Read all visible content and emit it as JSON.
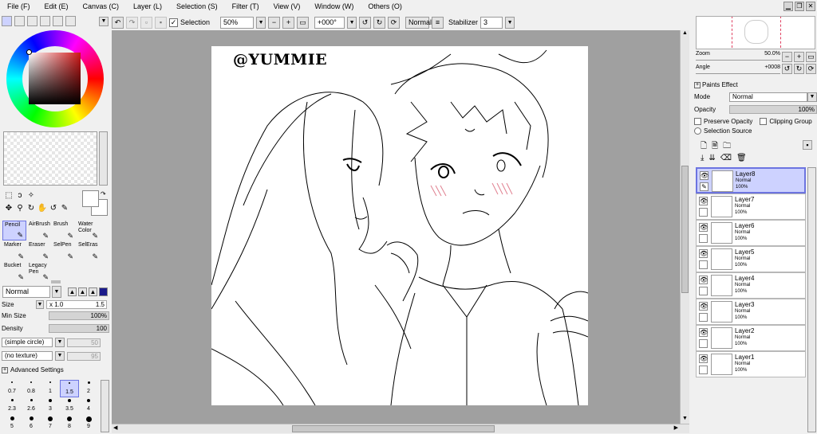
{
  "menu": [
    "File (F)",
    "Edit (E)",
    "Canvas (C)",
    "Layer (L)",
    "Selection (S)",
    "Filter (T)",
    "View (V)",
    "Window (W)",
    "Others (O)"
  ],
  "toolbar": {
    "selection_label": "Selection",
    "zoom": "50%",
    "angle": "+000°",
    "blend": "Normal",
    "stabilizer_label": "Stabilizer",
    "stabilizer_value": "3"
  },
  "brushes": [
    {
      "label": "Pencil",
      "icon": "pencil-icon"
    },
    {
      "label": "AirBrush",
      "icon": "airbrush-icon"
    },
    {
      "label": "Brush",
      "icon": "brush-icon"
    },
    {
      "label": "Water\nColor",
      "icon": "watercolor-icon"
    },
    {
      "label": "Marker",
      "icon": "marker-icon"
    },
    {
      "label": "Eraser",
      "icon": "eraser-icon"
    },
    {
      "label": "SelPen",
      "icon": "selpen-icon"
    },
    {
      "label": "SelEras",
      "icon": "seleras-icon"
    },
    {
      "label": "Bucket",
      "icon": "bucket-icon"
    },
    {
      "label": "Legacy\nPen",
      "icon": "legacy-pen-icon"
    }
  ],
  "tool_settings": {
    "blend_mode": "Normal",
    "size_label": "Size",
    "size_mult": "x 1.0",
    "size_value": "1.5",
    "min_size_label": "Min Size",
    "min_size_value": "100%",
    "density_label": "Density",
    "density_value": "100",
    "shape": "(simple circle)",
    "shape_value": "50",
    "texture": "(no texture)",
    "texture_value": "95",
    "advanced_label": "Advanced Settings"
  },
  "brush_sizes": [
    {
      "label": "0.7",
      "dot": 1
    },
    {
      "label": "0.8",
      "dot": 1
    },
    {
      "label": "1",
      "dot": 1
    },
    {
      "label": "1.5",
      "dot": 1,
      "selected": true
    },
    {
      "label": "2",
      "dot": 2
    },
    {
      "label": "2.3",
      "dot": 2
    },
    {
      "label": "2.6",
      "dot": 2
    },
    {
      "label": "3",
      "dot": 3
    },
    {
      "label": "3.5",
      "dot": 3
    },
    {
      "label": "4",
      "dot": 3
    },
    {
      "label": "5",
      "dot": 4
    },
    {
      "label": "6",
      "dot": 4
    },
    {
      "label": "7",
      "dot": 5
    },
    {
      "label": "8",
      "dot": 5
    },
    {
      "label": "9",
      "dot": 6
    }
  ],
  "canvas": {
    "watermark": "@YUMMIE"
  },
  "navigator": {
    "zoom_label": "Zoom",
    "zoom_value": "50.0%",
    "angle_label": "Angle",
    "angle_value": "+0008"
  },
  "layer_panel": {
    "paints_effect": "Paints Effect",
    "mode_label": "Mode",
    "mode_value": "Normal",
    "opacity_label": "Opacity",
    "opacity_value": "100%",
    "preserve_opacity": "Preserve Opacity",
    "clipping_group": "Clipping Group",
    "selection_source": "Selection Source"
  },
  "layers": [
    {
      "name": "Layer8",
      "mode": "Normal",
      "opacity": "100%",
      "selected": true
    },
    {
      "name": "Layer7",
      "mode": "Normal",
      "opacity": "100%"
    },
    {
      "name": "Layer6",
      "mode": "Normal",
      "opacity": "100%"
    },
    {
      "name": "Layer5",
      "mode": "Normal",
      "opacity": "100%"
    },
    {
      "name": "Layer4",
      "mode": "Normal",
      "opacity": "100%"
    },
    {
      "name": "Layer3",
      "mode": "Normal",
      "opacity": "100%"
    },
    {
      "name": "Layer2",
      "mode": "Normal",
      "opacity": "100%"
    },
    {
      "name": "Layer1",
      "mode": "Normal",
      "opacity": "100%"
    }
  ],
  "colors": {
    "accent": "#cdd2ff",
    "accent_border": "#6c74e0",
    "canvas_bg": "#a0a0a0"
  }
}
